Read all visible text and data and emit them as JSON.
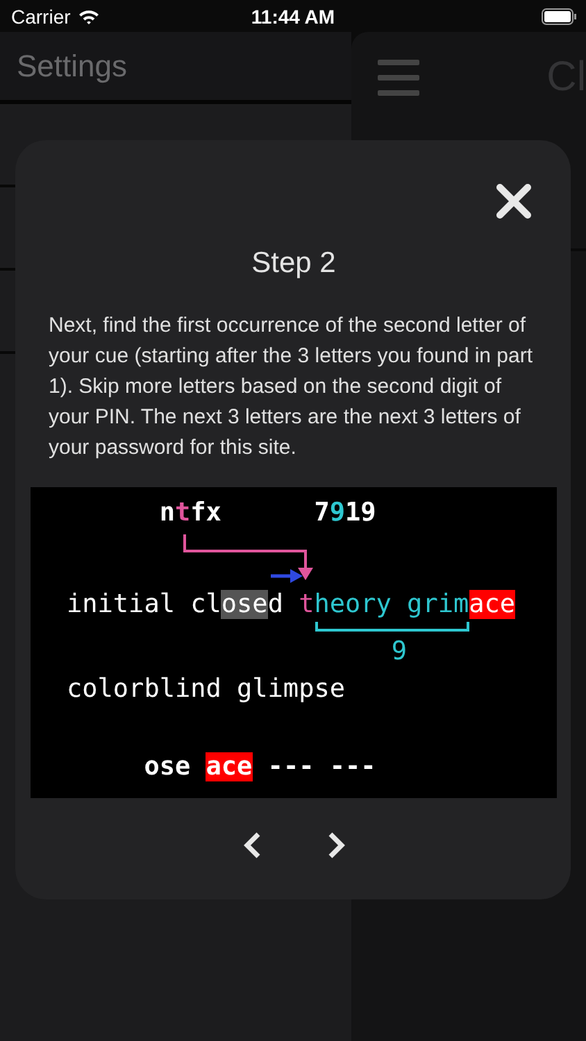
{
  "status_bar": {
    "carrier": "Carrier",
    "time": "11:44 AM"
  },
  "background": {
    "sidebar_title": "Settings",
    "main_title": "Cl"
  },
  "dialog": {
    "title": "Step 2",
    "text": "Next, find the first occurrence of the second letter of your cue (starting after the 3 letters you found in part 1). Skip more letters based on the second digit of your PIN. The next 3 letters are the next 3 letters of your password for this site.",
    "diagram": {
      "lines": [
        {
          "kind": "cue",
          "texts": [
            [
              {
                "text": "n",
                "kind": "plain"
              },
              {
                "text": "t",
                "kind": "pink"
              },
              {
                "text": "fx",
                "kind": "plain"
              }
            ],
            [
              {
                "text": "7",
                "kind": "plain"
              },
              {
                "text": "9",
                "kind": "cyan"
              },
              {
                "text": "19",
                "kind": "plain"
              }
            ]
          ]
        },
        {
          "kind": "sentence",
          "texts": [
            [
              {
                "text": "initial cl",
                "kind": "plain"
              },
              {
                "text": "ose",
                "kind": "gray-box"
              },
              {
                "text": "d ",
                "kind": "plain"
              },
              {
                "text": "t",
                "kind": "pink"
              },
              {
                "text": "heory grim",
                "kind": "cyan"
              },
              {
                "text": "ace",
                "kind": "red-box"
              }
            ]
          ]
        },
        {
          "kind": "count",
          "texts": [
            [
              {
                "text": "9",
                "kind": "cyan"
              }
            ]
          ]
        },
        {
          "kind": "words",
          "texts": [
            [
              {
                "text": "colorblind glimpse",
                "kind": "plain"
              }
            ]
          ]
        },
        {
          "kind": "result",
          "texts": [
            [
              {
                "text": "ose ",
                "kind": "plain"
              },
              {
                "text": "ace",
                "kind": "red-box"
              },
              {
                "text": " --- ---",
                "kind": "plain"
              }
            ]
          ]
        }
      ]
    }
  }
}
